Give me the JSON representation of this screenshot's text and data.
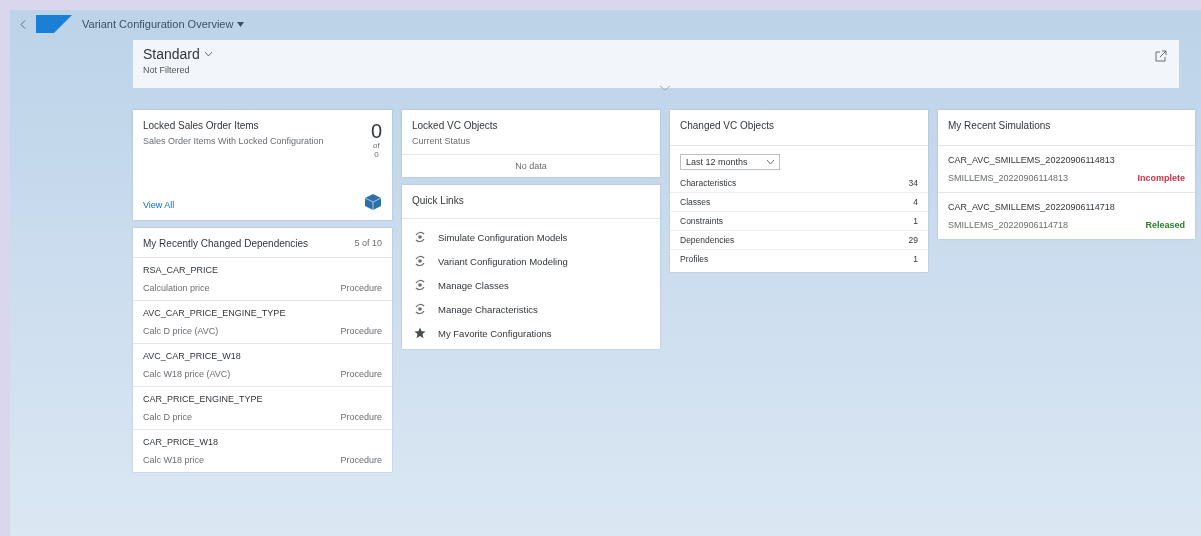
{
  "shell": {
    "title": "Variant Configuration Overview"
  },
  "filter_bar": {
    "variant": "Standard",
    "status": "Not Filtered"
  },
  "locked_sales_orders": {
    "title": "Locked Sales Order Items",
    "subtitle": "Sales Order Items With Locked Configuration",
    "count": "0",
    "of": "of",
    "total": "0",
    "footer": "View All"
  },
  "dependencies": {
    "title": "My Recently Changed Dependencies",
    "count": "5 of 10",
    "rows": [
      {
        "name": "RSA_CAR_PRICE",
        "description": "Calculation price",
        "type": "Procedure"
      },
      {
        "name": "AVC_CAR_PRICE_ENGINE_TYPE",
        "description": "Calc D price (AVC)",
        "type": "Procedure"
      },
      {
        "name": "AVC_CAR_PRICE_W18",
        "description": "Calc W18 price (AVC)",
        "type": "Procedure"
      },
      {
        "name": "CAR_PRICE_ENGINE_TYPE",
        "description": "Calc D price",
        "type": "Procedure"
      },
      {
        "name": "CAR_PRICE_W18",
        "description": "Calc W18 price",
        "type": "Procedure"
      }
    ]
  },
  "locked_vc_objects": {
    "title": "Locked VC Objects",
    "subtitle": "Current Status",
    "empty": "No data"
  },
  "quick_links": {
    "title": "Quick Links",
    "items": [
      {
        "label": "Simulate Configuration Models",
        "kind": "app"
      },
      {
        "label": "Variant Configuration Modeling",
        "kind": "app"
      },
      {
        "label": "Manage Classes",
        "kind": "app"
      },
      {
        "label": "Manage Characteristics",
        "kind": "app"
      },
      {
        "label": "My Favorite Configurations",
        "kind": "favorite"
      }
    ]
  },
  "changed_vc_objects": {
    "title": "Changed VC Objects",
    "period": "Last 12 months",
    "rows": [
      {
        "label": "Characteristics",
        "value": "34"
      },
      {
        "label": "Classes",
        "value": "4"
      },
      {
        "label": "Constraints",
        "value": "1"
      },
      {
        "label": "Dependencies",
        "value": "29"
      },
      {
        "label": "Profiles",
        "value": "1"
      }
    ]
  },
  "simulations": {
    "title": "My Recent Simulations",
    "rows": [
      {
        "name": "CAR_AVC_SMILLEMS_20220906114813",
        "id": "SMILLEMS_20220906114813",
        "status": "Incomplete",
        "color": "#d0314a"
      },
      {
        "name": "CAR_AVC_SMILLEMS_20220906114718",
        "id": "SMILLEMS_20220906114718",
        "status": "Released",
        "color": "#2b7d2b"
      }
    ]
  }
}
